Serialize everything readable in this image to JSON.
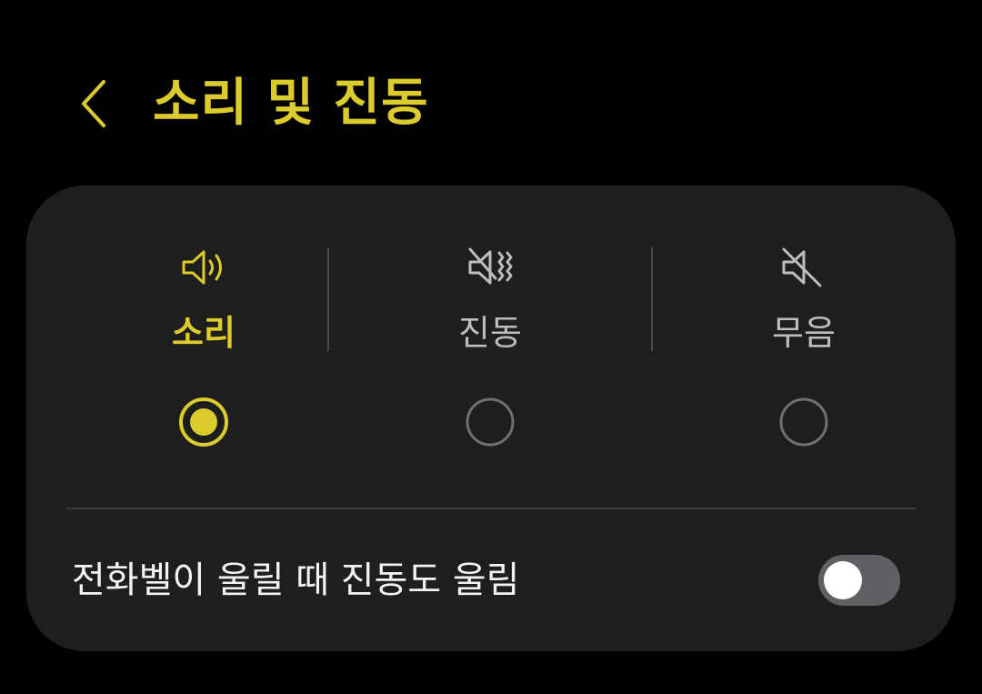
{
  "header": {
    "title": "소리 및 진동",
    "back_icon": "chevron-left-icon"
  },
  "sound_modes": {
    "selected": "sound",
    "items": [
      {
        "id": "sound",
        "label": "소리",
        "icon": "speaker-sound-icon",
        "selected": true
      },
      {
        "id": "vibrate",
        "label": "진동",
        "icon": "speaker-vibrate-icon",
        "selected": false
      },
      {
        "id": "mute",
        "label": "무음",
        "icon": "speaker-mute-icon",
        "selected": false
      }
    ]
  },
  "vibrate_while_ringing": {
    "label": "전화벨이 울릴 때 진동도 울림",
    "enabled": false
  },
  "colors": {
    "accent": "#dccb2c",
    "background": "#000000",
    "card": "#1e1e1e",
    "inactive": "#707070",
    "switch_off_track": "#5f5f64"
  }
}
